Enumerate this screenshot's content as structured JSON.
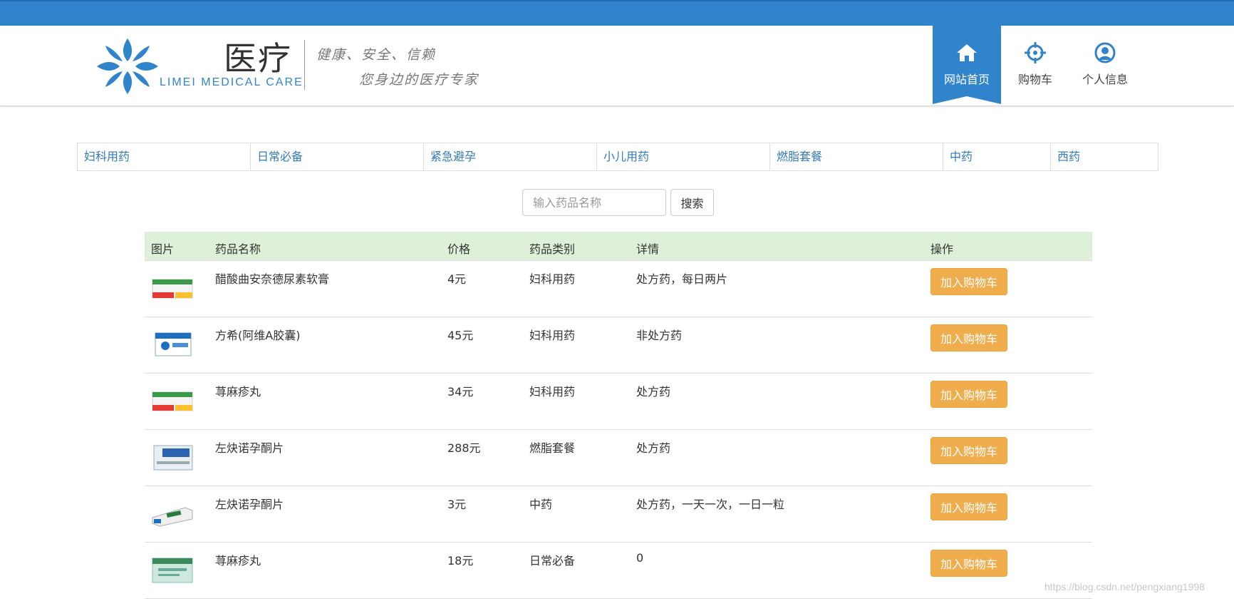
{
  "header": {
    "brand_cn": "医疗",
    "brand_en": "LIMEI MEDICAL CARE",
    "slogan_line1": "健康、安全、信赖",
    "slogan_line2": "您身边的医疗专家",
    "nav": [
      {
        "label": "网站首页",
        "icon": "home-icon",
        "active": true
      },
      {
        "label": "购物车",
        "icon": "crosshair-icon",
        "active": false
      },
      {
        "label": "个人信息",
        "icon": "user-icon",
        "active": false
      }
    ]
  },
  "categories": [
    "妇科用药",
    "日常必备",
    "紧急避孕",
    "小儿用药",
    "燃脂套餐",
    "中药",
    "西药"
  ],
  "search": {
    "placeholder": "输入药品名称",
    "button_label": "搜索"
  },
  "table": {
    "headers": [
      "图片",
      "药品名称",
      "价格",
      "药品类别",
      "详情",
      "操作"
    ],
    "add_label": "加入购物车",
    "rows": [
      {
        "name": "醋酸曲安奈德尿素软膏",
        "price": "4元",
        "category": "妇科用药",
        "detail": "处方药，每日两片"
      },
      {
        "name": "方希(阿维A胶囊)",
        "price": "45元",
        "category": "妇科用药",
        "detail": "非处方药"
      },
      {
        "name": "荨麻疹丸",
        "price": "34元",
        "category": "妇科用药",
        "detail": "处方药"
      },
      {
        "name": "左炔诺孕酮片",
        "price": "288元",
        "category": "燃脂套餐",
        "detail": "处方药"
      },
      {
        "name": "左炔诺孕酮片",
        "price": "3元",
        "category": "中药",
        "detail": "处方药，一天一次，一日一粒"
      },
      {
        "name": "荨麻疹丸",
        "price": "18元",
        "category": "日常必备",
        "detail": "0"
      }
    ]
  },
  "watermark": "https://blog.csdn.net/pengxiang1998",
  "colors": {
    "brand_blue": "#2f84cc",
    "table_header_bg": "#dff0d8",
    "add_button": "#f0ad4e",
    "category_link": "#337ab7"
  }
}
